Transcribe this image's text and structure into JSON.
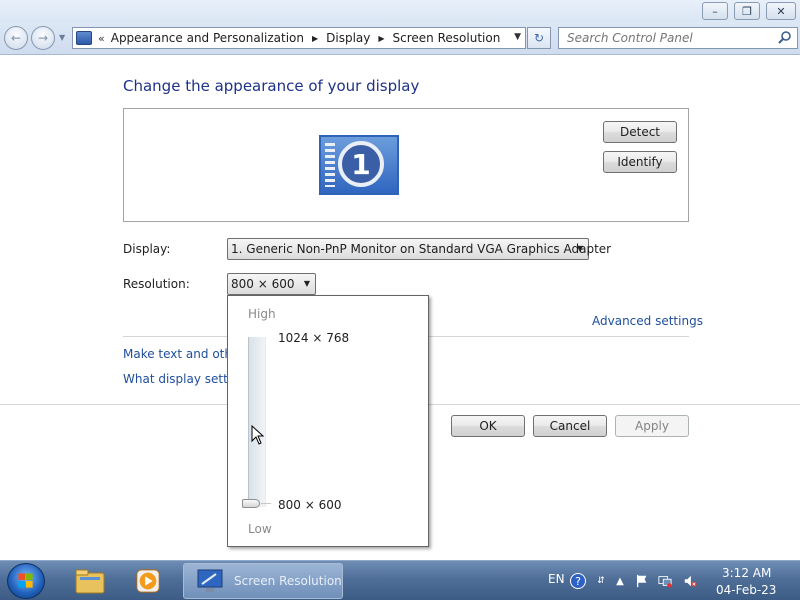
{
  "window": {
    "minimize_glyph": "–",
    "maximize_glyph": "❐",
    "close_glyph": "✕"
  },
  "address": {
    "back_glyph": "←",
    "forward_glyph": "→",
    "prefix": "«",
    "crumbs": [
      "Appearance and Personalization",
      "Display",
      "Screen Resolution"
    ],
    "refresh_glyph": "↻"
  },
  "search": {
    "placeholder": "Search Control Panel"
  },
  "main": {
    "heading": "Change the appearance of your display",
    "monitor_number": "1",
    "detect_label": "Detect",
    "identify_label": "Identify",
    "display_label": "Display:",
    "display_value": "1. Generic Non-PnP Monitor on Standard VGA Graphics Adapter",
    "resolution_label": "Resolution:",
    "resolution_value": "800 × 600",
    "advanced_link": "Advanced settings",
    "link_text_size": "Make text and other",
    "link_display_settings": "What display setting",
    "ok_label": "OK",
    "cancel_label": "Cancel",
    "apply_label": "Apply"
  },
  "resolution_popup": {
    "high_label": "High",
    "max_value": "1024 × 768",
    "min_value": "800 × 600",
    "low_label": "Low",
    "slider_fraction": 0
  },
  "taskbar": {
    "task_label": "Screen Resolution",
    "language": "EN",
    "time": "3:12 AM",
    "date": "04-Feb-23"
  },
  "colors": {
    "heading": "#1e3287",
    "link": "#1e4e9c",
    "taskbar": "#4f6f99",
    "accent": "#2f66bf"
  }
}
